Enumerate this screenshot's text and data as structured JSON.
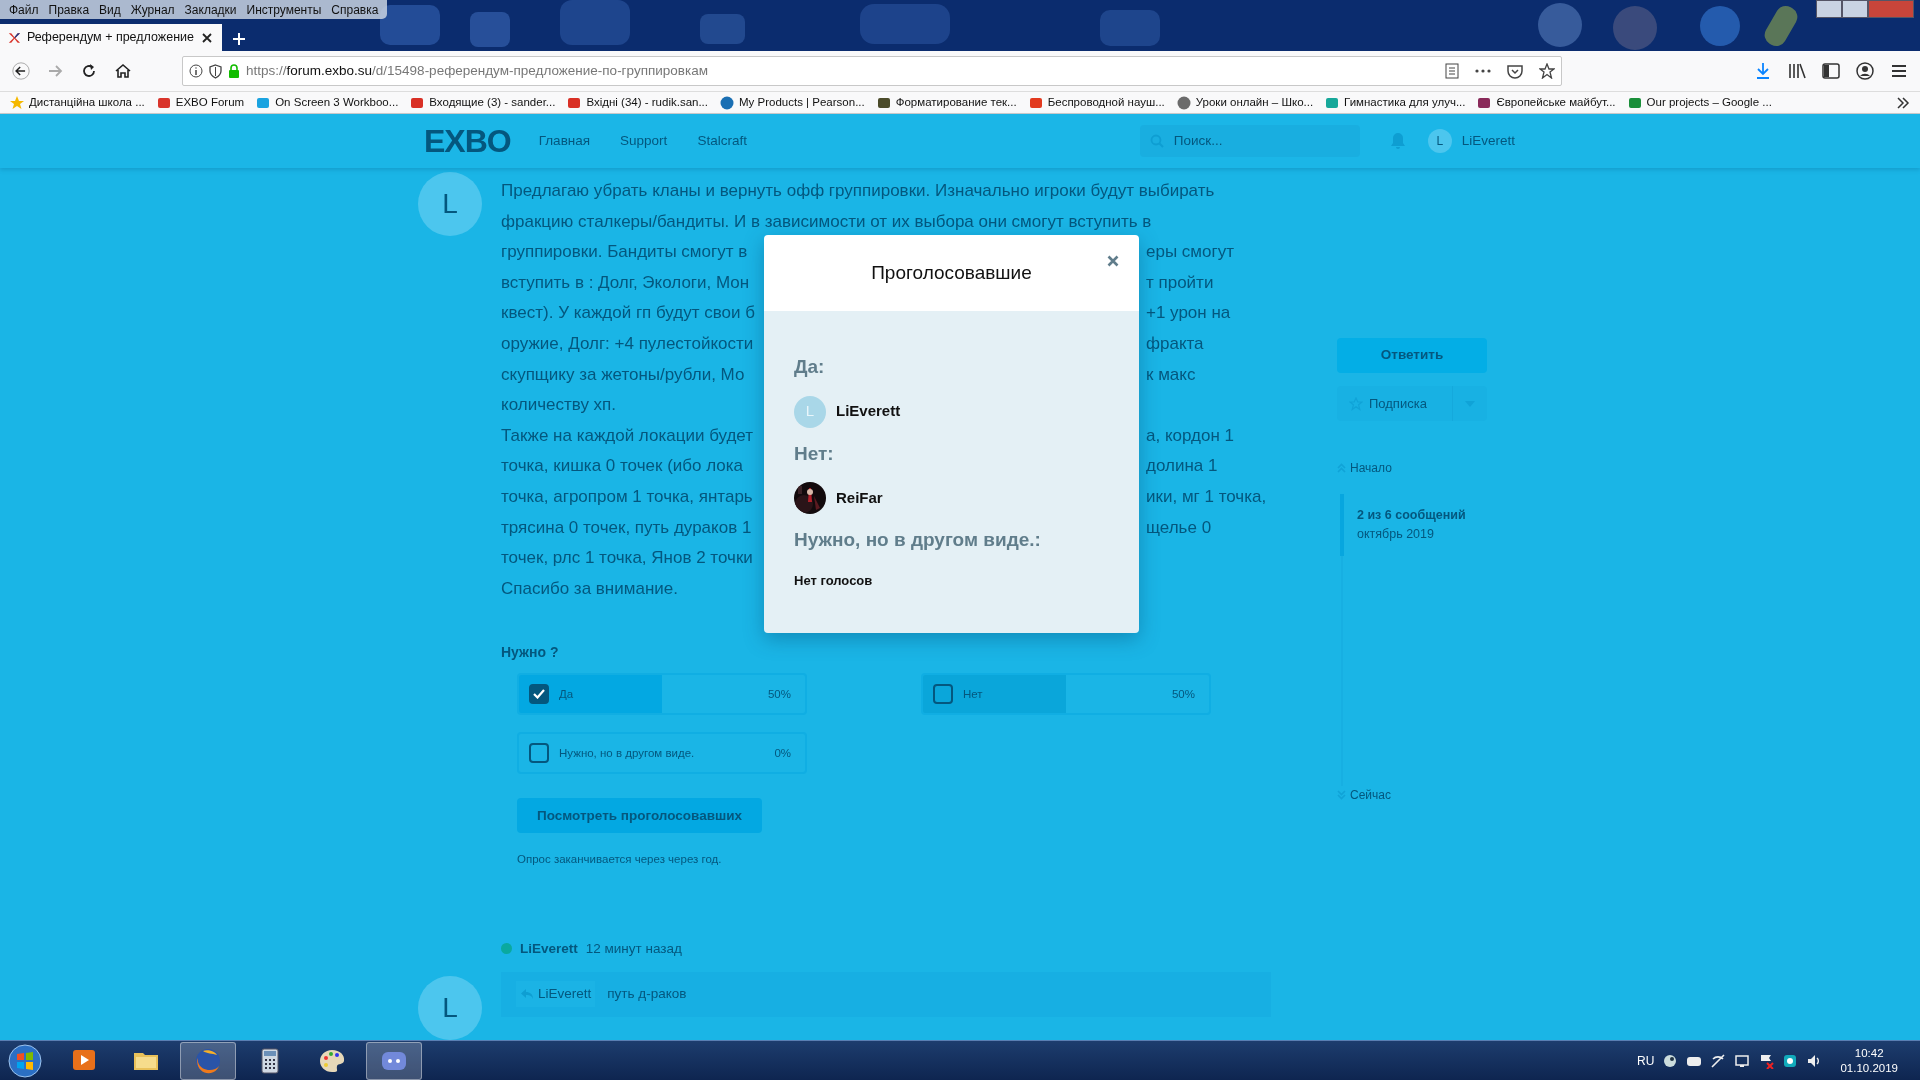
{
  "browser": {
    "menu": [
      "Файл",
      "Правка",
      "Вид",
      "Журнал",
      "Закладки",
      "Инструменты",
      "Справка"
    ],
    "tab": {
      "title": "Референдум + предложение",
      "selected": true
    },
    "url": {
      "scheme": "https://",
      "host": "forum.exbo.su",
      "path": "/d/15498-референдум-предложение-по-группировкам"
    },
    "bookmarks": [
      "Дистанційна школа ...",
      "EXBO Forum",
      "On Screen 3 Workboo...",
      "Входящие (3) - sander...",
      "Вхідні (34) - rudik.san...",
      "My Products | Pearson...",
      "Форматирование тек...",
      "Беспроводной науш...",
      "Уроки онлайн – Шко...",
      "Гимнастика для улуч...",
      "Європейське майбут...",
      "Our projects – Google ..."
    ]
  },
  "forum": {
    "logo": "EXBO",
    "nav": [
      "Главная",
      "Support",
      "Stalcraft"
    ],
    "search": {
      "placeholder": "Поиск..."
    },
    "user": {
      "name": "LiEverett",
      "initial": "L"
    }
  },
  "post": {
    "author_initial": "L",
    "lines": [
      {
        "left": "Предлагаю убрать кланы и вернуть офф группировки. Изначально игроки будут выбирать"
      },
      {
        "left": "фракцию сталкеры/бандиты. И в зависимости от их выбора они смогут вступить в"
      },
      {
        "left": "группировки. Бандиты смогут в",
        "right": "еры смогут"
      },
      {
        "left": "вступить в : Долг, Экологи, Мон",
        "right": "т пройти"
      },
      {
        "left": "квест). У каждой гп будут свои б",
        "right": "+1 урон на"
      },
      {
        "left": "оружие, Долг: +4 пулестойкости",
        "right": "фракта"
      },
      {
        "left": "скупщику за жетоны/рубли, Мо",
        "right": "к макс"
      },
      {
        "left": "количеству хп."
      },
      {
        "left": "Также на каждой локации будет",
        "right": "а, кордон 1"
      },
      {
        "left": "точка, кишка 0 точек (ибо лока",
        "right": "долина 1"
      },
      {
        "left": "точка, агропром 1 точка, янтарь",
        "right": "ики, мг 1 точка,"
      },
      {
        "left": "трясина 0 точек, путь дураков 1",
        "right": "щелье 0"
      },
      {
        "left": "точек, рлс 1 точка, Янов 2 точки"
      },
      {
        "left": "Спасибо за внимание."
      }
    ],
    "poll": {
      "question": "Нужно ?",
      "options": [
        {
          "label": "Да",
          "percent": "50%",
          "level": 0.5,
          "checked": true
        },
        {
          "label": "Нет",
          "percent": "50%",
          "level": 0.5,
          "checked": false
        },
        {
          "label": "Нужно, но в другом виде.",
          "percent": "0%",
          "level": 0,
          "checked": false
        }
      ],
      "button": "Посмотреть проголосовавших",
      "note": "Опрос заканчивается через через год."
    }
  },
  "reply": {
    "author": "LiEverett",
    "time": "12 минут назад",
    "initial": "L",
    "quote_user": "LiEverett",
    "text": "путь д-раков"
  },
  "sidebar": {
    "reply_button": "Ответить",
    "subscribe": "Подписка",
    "start": "Начало",
    "position": "2 из 6 сообщений",
    "date": "октябрь 2019",
    "now": "Сейчас"
  },
  "modal": {
    "title": "Проголосовавшие",
    "groups": [
      {
        "title": "Да:",
        "voters": [
          {
            "name": "LiEverett",
            "initial": "L",
            "kind": "letter"
          }
        ]
      },
      {
        "title": "Нет:",
        "voters": [
          {
            "name": "ReiFar",
            "kind": "picture"
          }
        ]
      },
      {
        "title": "Нужно, но в другом виде.:",
        "empty": "Нет голосов"
      }
    ]
  },
  "taskbar": {
    "language": "RU",
    "time": "10:42",
    "date": "01.10.2019"
  }
}
